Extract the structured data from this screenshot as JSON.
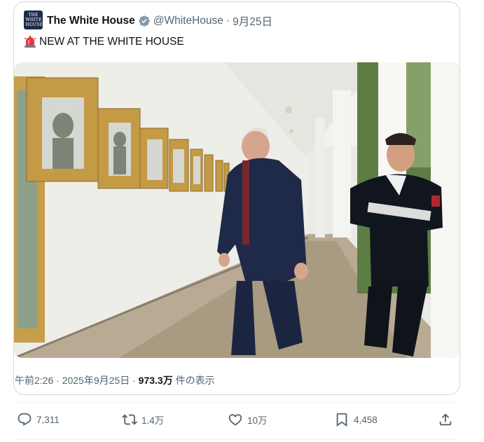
{
  "tweet": {
    "display_name": "The White House",
    "handle": "@WhiteHouse",
    "separator": "·",
    "date": "9月25日",
    "text": "NEW AT THE WHITE HOUSE",
    "avatar_text": "THE WHITE HOUSE",
    "verified_icon": "verified-badge-icon",
    "siren_icon": "siren-emoji"
  },
  "meta": {
    "time": "午前2:26",
    "sep1": " · ",
    "full_date": "2025年9月25日",
    "sep2": " · ",
    "views": "973.3万",
    "views_suffix": " 件の表示"
  },
  "actions": {
    "replies": "7,311",
    "reposts": "1.4万",
    "likes": "10万",
    "bookmarks": "4,458"
  },
  "colors": {
    "text": "#0f1419",
    "secondary": "#536471",
    "border": "#cfd9de",
    "verified": "#829aab",
    "navy_suit": "#1f2a48"
  }
}
